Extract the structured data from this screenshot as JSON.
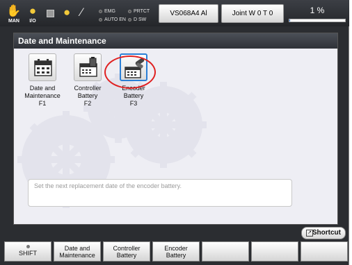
{
  "topbar": {
    "mode_label": "MAN",
    "io_label": "I/O",
    "indicators": [
      {
        "label": "EMG"
      },
      {
        "label": "PRTCT"
      },
      {
        "label": "AUTO EN"
      },
      {
        "label": "D SW"
      }
    ],
    "model": "VS068A4 Al",
    "joint": "Joint W 0 T 0",
    "speed_text": "1 %",
    "speed_value_percent": 1
  },
  "panel": {
    "title": "Date and Maintenance",
    "tiles": [
      {
        "icon": "calendar-icon",
        "label_line1": "Date and",
        "label_line2": "Maintenance",
        "label_line3": "F1"
      },
      {
        "icon": "controller-battery-icon",
        "label_line1": "Controller",
        "label_line2": "Battery",
        "label_line3": "F2"
      },
      {
        "icon": "encoder-battery-icon",
        "label_line1": "Encoder",
        "label_line2": "Battery",
        "label_line3": "F3"
      }
    ],
    "message": "Set the next replacement date of the encoder battery."
  },
  "shortcut_label": "Shortcut",
  "function_keys": [
    {
      "line1": "SHIFT",
      "line2": ""
    },
    {
      "line1": "Date and",
      "line2": "Maintenance"
    },
    {
      "line1": "Controller",
      "line2": "Battery"
    },
    {
      "line1": "Encoder",
      "line2": "Battery"
    },
    {
      "line1": "",
      "line2": ""
    },
    {
      "line1": "",
      "line2": ""
    },
    {
      "line1": "",
      "line2": ""
    }
  ],
  "colors": {
    "accent": "#2a7fd6",
    "highlight": "#e02020",
    "title_bar": "#3a3d44"
  }
}
